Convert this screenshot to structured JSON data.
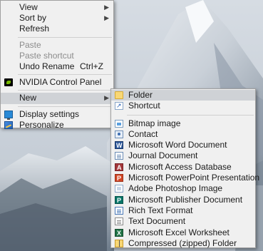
{
  "context_menu": {
    "items": [
      {
        "label": "View",
        "submenu": true
      },
      {
        "label": "Sort by",
        "submenu": true
      },
      {
        "label": "Refresh"
      },
      {
        "label": "Paste",
        "disabled": true
      },
      {
        "label": "Paste shortcut",
        "disabled": true
      },
      {
        "label": "Undo Rename",
        "shortcut": "Ctrl+Z"
      },
      {
        "label": "NVIDIA Control Panel",
        "icon": "nvidia-icon"
      },
      {
        "label": "New",
        "submenu": true,
        "highlighted": true
      },
      {
        "label": "Display settings",
        "icon": "display-settings-icon"
      },
      {
        "label": "Personalize",
        "icon": "personalize-icon"
      }
    ]
  },
  "new_menu": {
    "items": [
      {
        "label": "Folder",
        "icon": "folder-icon",
        "highlighted": true
      },
      {
        "label": "Shortcut",
        "icon": "shortcut-icon"
      },
      {
        "label": "Bitmap image",
        "icon": "bitmap-image-icon"
      },
      {
        "label": "Contact",
        "icon": "contact-icon"
      },
      {
        "label": "Microsoft Word Document",
        "icon": "word-document-icon"
      },
      {
        "label": "Journal Document",
        "icon": "journal-document-icon"
      },
      {
        "label": "Microsoft Access Database",
        "icon": "access-database-icon"
      },
      {
        "label": "Microsoft PowerPoint Presentation",
        "icon": "powerpoint-presentation-icon"
      },
      {
        "label": "Adobe Photoshop Image",
        "icon": "photoshop-image-icon"
      },
      {
        "label": "Microsoft Publisher Document",
        "icon": "publisher-document-icon"
      },
      {
        "label": "Rich Text Format",
        "icon": "rich-text-icon"
      },
      {
        "label": "Text Document",
        "icon": "text-document-icon"
      },
      {
        "label": "Microsoft Excel Worksheet",
        "icon": "excel-worksheet-icon"
      },
      {
        "label": "Compressed (zipped) Folder",
        "icon": "zip-folder-icon"
      }
    ]
  },
  "icons": {
    "submenu_arrow": "chevron-right-icon"
  },
  "colors": {
    "menu_bg": "#f0f0f0",
    "highlight": "#cfd2d6",
    "disabled_text": "#8c8c8c"
  }
}
